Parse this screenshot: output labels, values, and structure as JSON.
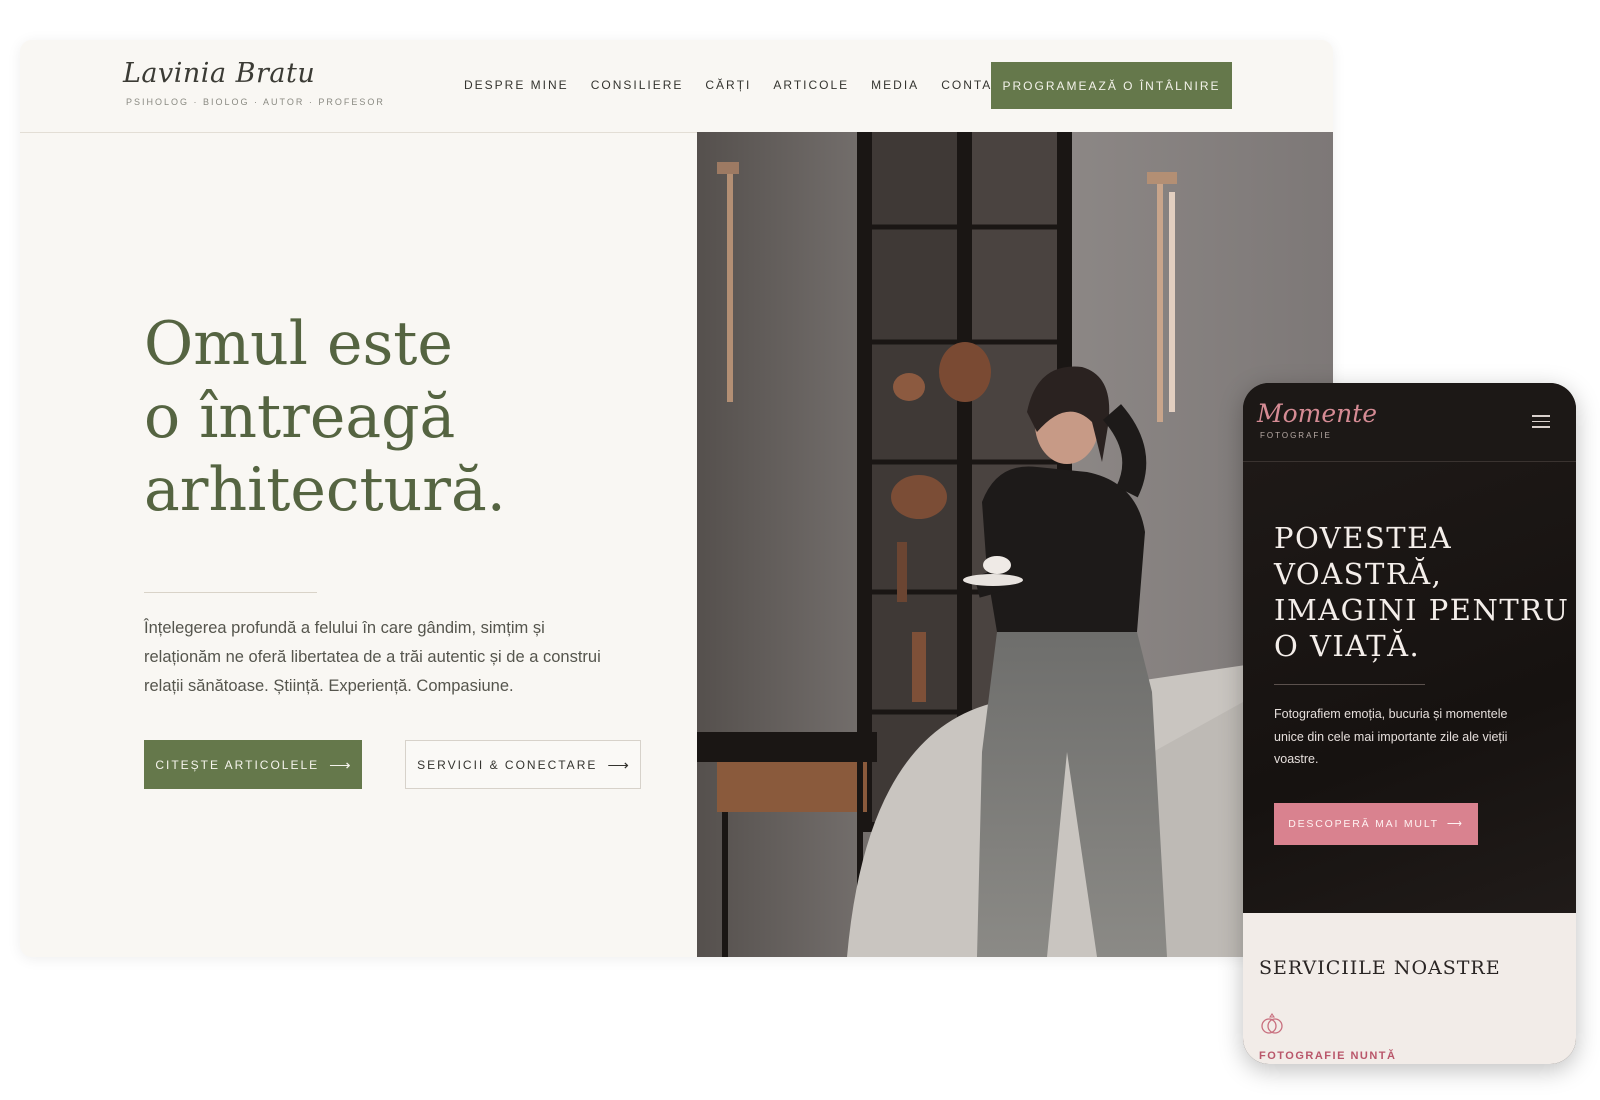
{
  "desktop": {
    "logo": {
      "name": "Lavinia Bratu",
      "tagline": "PSIHOLOG · BIOLOG · AUTOR · PROFESOR"
    },
    "nav": [
      "DESPRE MINE",
      "CONSILIERE",
      "CĂRȚI",
      "ARTICOLE",
      "MEDIA",
      "CONTACT"
    ],
    "cta_label": "PROGRAMEAZĂ O ÎNTÂLNIRE",
    "hero": {
      "title_lines": [
        "Omul este",
        "o întreagă",
        "arhitectură."
      ],
      "text": "Înțelegerea profundă a felului în care gândim, simțim și relaționăm ne oferă libertatea de a trăi autentic și de a construi relații sănătoase. Știință. Experiență. Compasiune.",
      "primary_button": "CITEȘTE ARTICOLELE",
      "secondary_button": "SERVICII & CONECTARE",
      "arrow": "⟶"
    },
    "colors": {
      "accent": "#65784b",
      "background": "#f9f7f3",
      "title": "#556441"
    }
  },
  "mobile": {
    "logo": {
      "name": "Momente",
      "subtitle": "FOTOGRAFIE"
    },
    "hero": {
      "title_lines": [
        "POVESTEA",
        "VOASTRĂ,",
        "IMAGINI PENTRU",
        "O VIAȚĂ."
      ],
      "text": "Fotografiem emoția, bucuria și momentele unice din cele mai importante zile ale vieții voastre.",
      "button": "DESCOPERĂ MAI MULT",
      "arrow": "⟶"
    },
    "services": {
      "title": "SERVICIILE NOASTRE",
      "first_item": "FOTOGRAFIE NUNTĂ"
    },
    "colors": {
      "accent": "#d9828f",
      "background": "#1b1715",
      "services_bg": "#f2ece8"
    }
  }
}
